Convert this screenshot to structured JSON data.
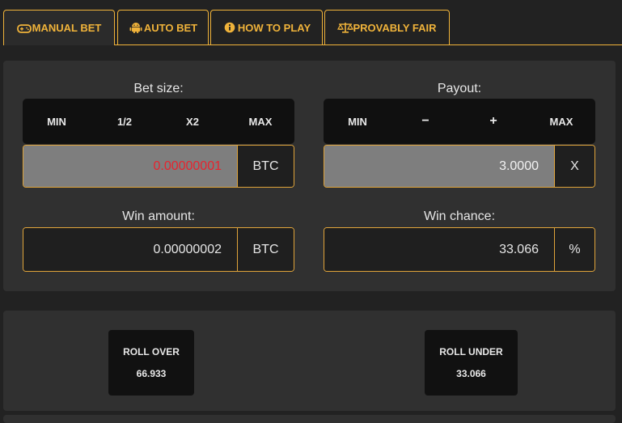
{
  "tabs": [
    {
      "label": "MANUAL BET",
      "icon": "gamepad-icon",
      "active": true
    },
    {
      "label": "AUTO BET",
      "icon": "android-icon",
      "active": false
    },
    {
      "label": "HOW TO PLAY",
      "icon": "info-icon",
      "active": false
    },
    {
      "label": "PROVABLY FAIR",
      "icon": "scale-icon",
      "active": false
    }
  ],
  "colors": {
    "accent": "#f0b33a",
    "panel": "#303030",
    "background": "#222222",
    "bet_value": "#e8232e"
  },
  "bet_size": {
    "title": "Bet size:",
    "buttons": [
      "MIN",
      "1/2",
      "X2",
      "MAX"
    ],
    "value": "0.00000001",
    "unit": "BTC"
  },
  "payout": {
    "title": "Payout:",
    "buttons": [
      "MIN",
      "−",
      "+",
      "MAX"
    ],
    "value": "3.0000",
    "unit": "X"
  },
  "win_amount": {
    "title": "Win amount:",
    "value": "0.00000002",
    "unit": "BTC"
  },
  "win_chance": {
    "title": "Win chance:",
    "value": "33.066",
    "unit": "%"
  },
  "roll_over": {
    "label": "ROLL OVER",
    "value": "66.933"
  },
  "roll_under": {
    "label": "ROLL UNDER",
    "value": "33.066"
  }
}
